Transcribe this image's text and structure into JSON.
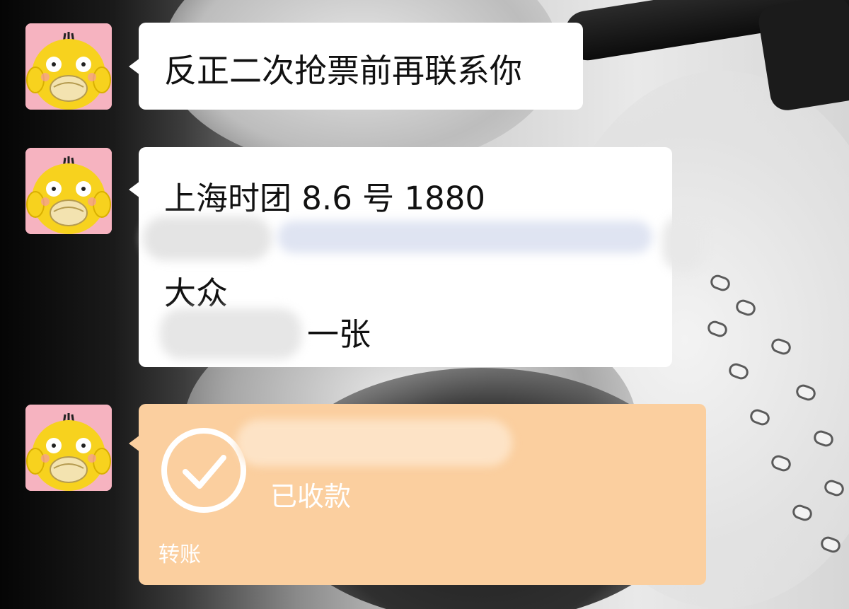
{
  "messages": [
    {
      "text": "反正二次抢票前再联系你"
    },
    {
      "lines": [
        "上海时团 8.6 号 1880",
        "大众",
        "一张"
      ]
    },
    {
      "transfer": {
        "status": "已收款",
        "footer": "转账"
      }
    }
  ],
  "colors": {
    "bubble_bg": "#ffffff",
    "transfer_bg": "#fbcf9f",
    "avatar_bg": "#f6b3c0",
    "duck_yellow": "#f7d21e"
  },
  "icons": {
    "avatar": "psyduck-avatar",
    "transfer": "check-circle-icon"
  }
}
